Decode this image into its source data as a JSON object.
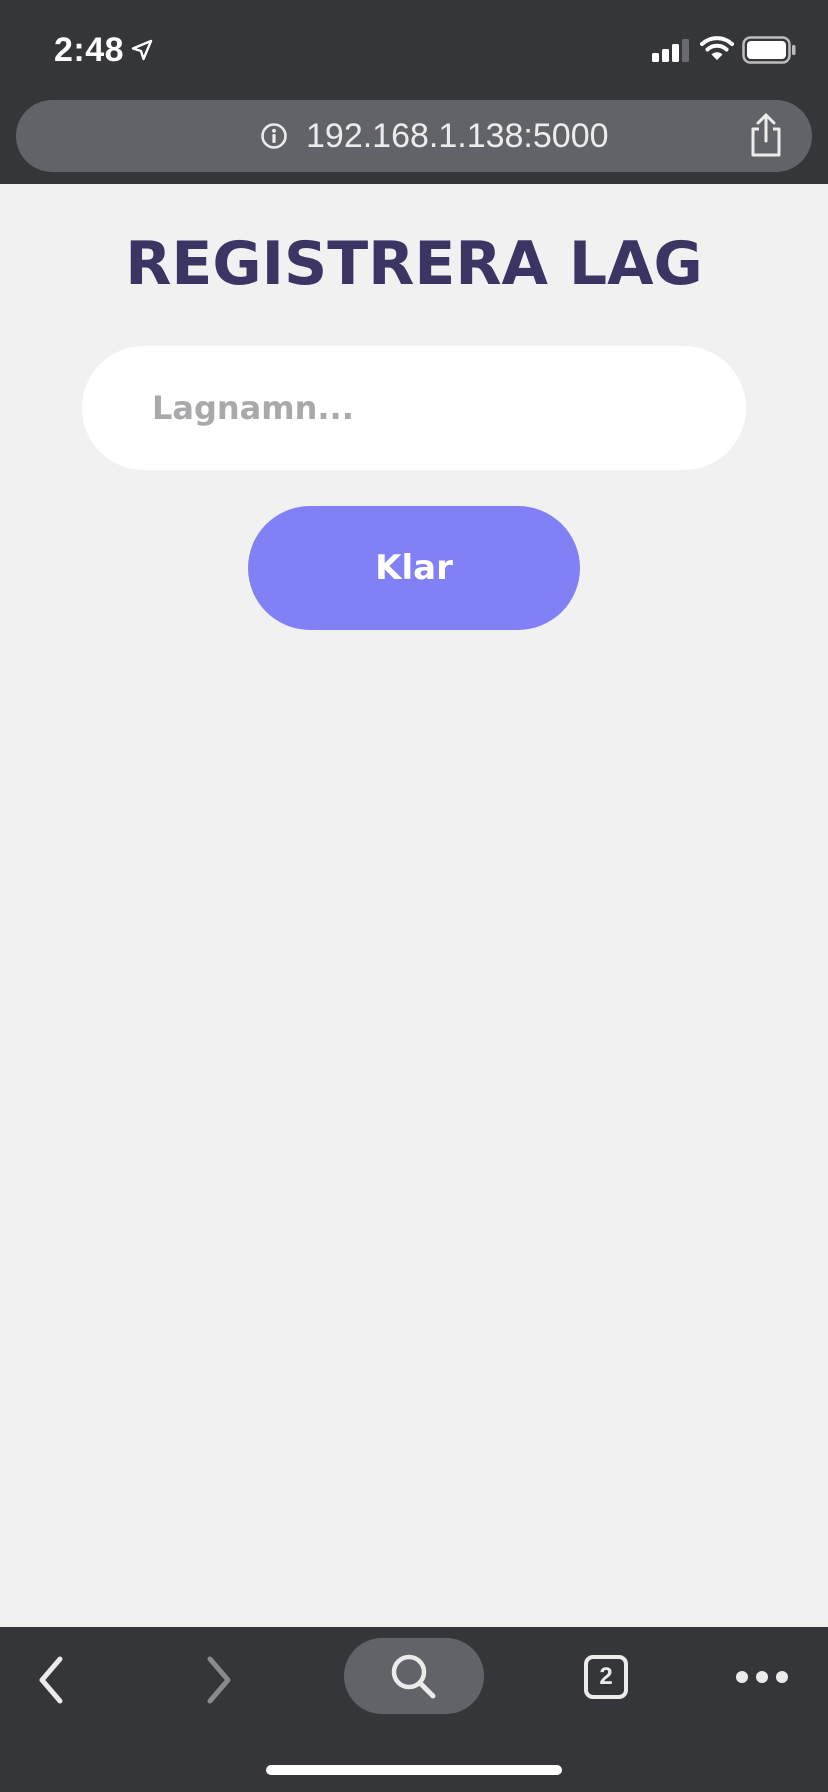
{
  "status_bar": {
    "time": "2:48",
    "icons": [
      "location-arrow-icon",
      "cellular-signal-icon",
      "wifi-icon",
      "battery-icon"
    ]
  },
  "address_bar": {
    "url": "192.168.1.138:5000",
    "icons": [
      "info-icon",
      "share-icon"
    ]
  },
  "page": {
    "title": "REGISTRERA LAG",
    "team_input": {
      "value": "",
      "placeholder": "Lagnamn..."
    },
    "done_button_label": "Klar"
  },
  "toolbar": {
    "tab_count": "2",
    "icons": [
      "back-icon",
      "forward-icon",
      "search-icon",
      "tabs-icon",
      "more-icon"
    ]
  },
  "colors": {
    "chrome_background": "#35363a",
    "pill_background": "#616368",
    "page_background": "#f1f1f2",
    "title": "#3b3564",
    "button": "#8181f5",
    "placeholder": "#a9a9ab"
  }
}
